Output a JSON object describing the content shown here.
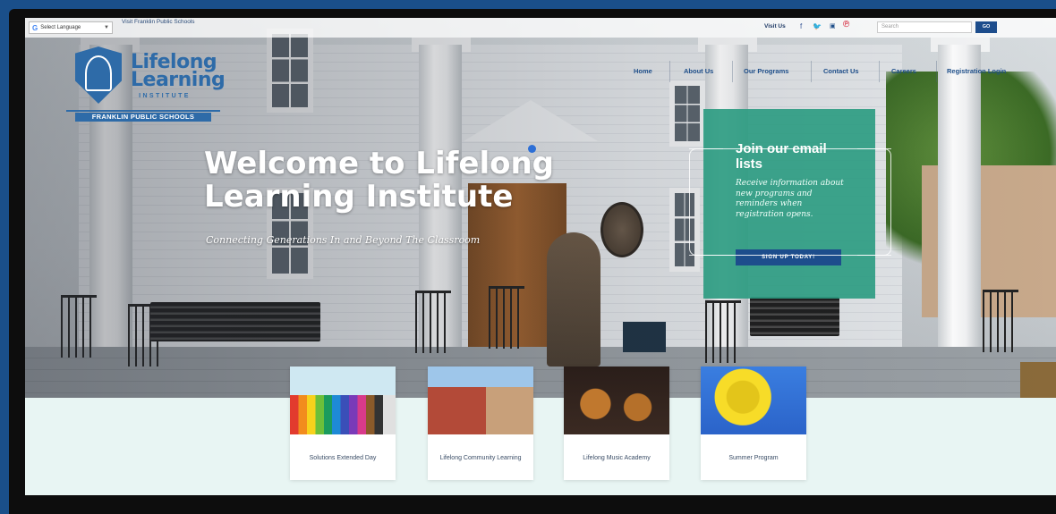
{
  "topbar": {
    "language_select": "Select Language",
    "visit_fps": "Visit Franklin Public Schools",
    "visit_us": "Visit Us",
    "search_placeholder": "Search",
    "go_label": "GO"
  },
  "logo": {
    "line1": "Lifelong",
    "line2": "Learning",
    "line3": "INSTITUTE",
    "band": "FRANKLIN PUBLIC SCHOOLS"
  },
  "nav": {
    "items": [
      "Home",
      "About Us",
      "Our Programs",
      "Contact Us",
      "Careers",
      "Registration Login"
    ]
  },
  "hero": {
    "title": "Welcome to Lifelong Learning Institute",
    "tagline": "Connecting Generations In and Beyond The Classroom"
  },
  "join": {
    "title": "Join our email lists",
    "description": "Receive information about new programs and reminders when registration opens.",
    "button": "SIGN UP TODAY!"
  },
  "cards": [
    {
      "label": "Solutions Extended Day",
      "image": "colored-pencils"
    },
    {
      "label": "Lifelong Community Learning",
      "image": "school-building"
    },
    {
      "label": "Lifelong Music Academy",
      "image": "orchestra"
    },
    {
      "label": "Summer Program",
      "image": "sunflower"
    }
  ],
  "colors": {
    "brand_blue": "#2e6ba8",
    "nav_blue": "#1d4d8c",
    "join_green": "#2e9c82",
    "bg_mint": "#e8f5f3"
  },
  "social_icons": [
    "facebook-icon",
    "twitter-icon",
    "youtube-icon",
    "pinterest-icon"
  ]
}
